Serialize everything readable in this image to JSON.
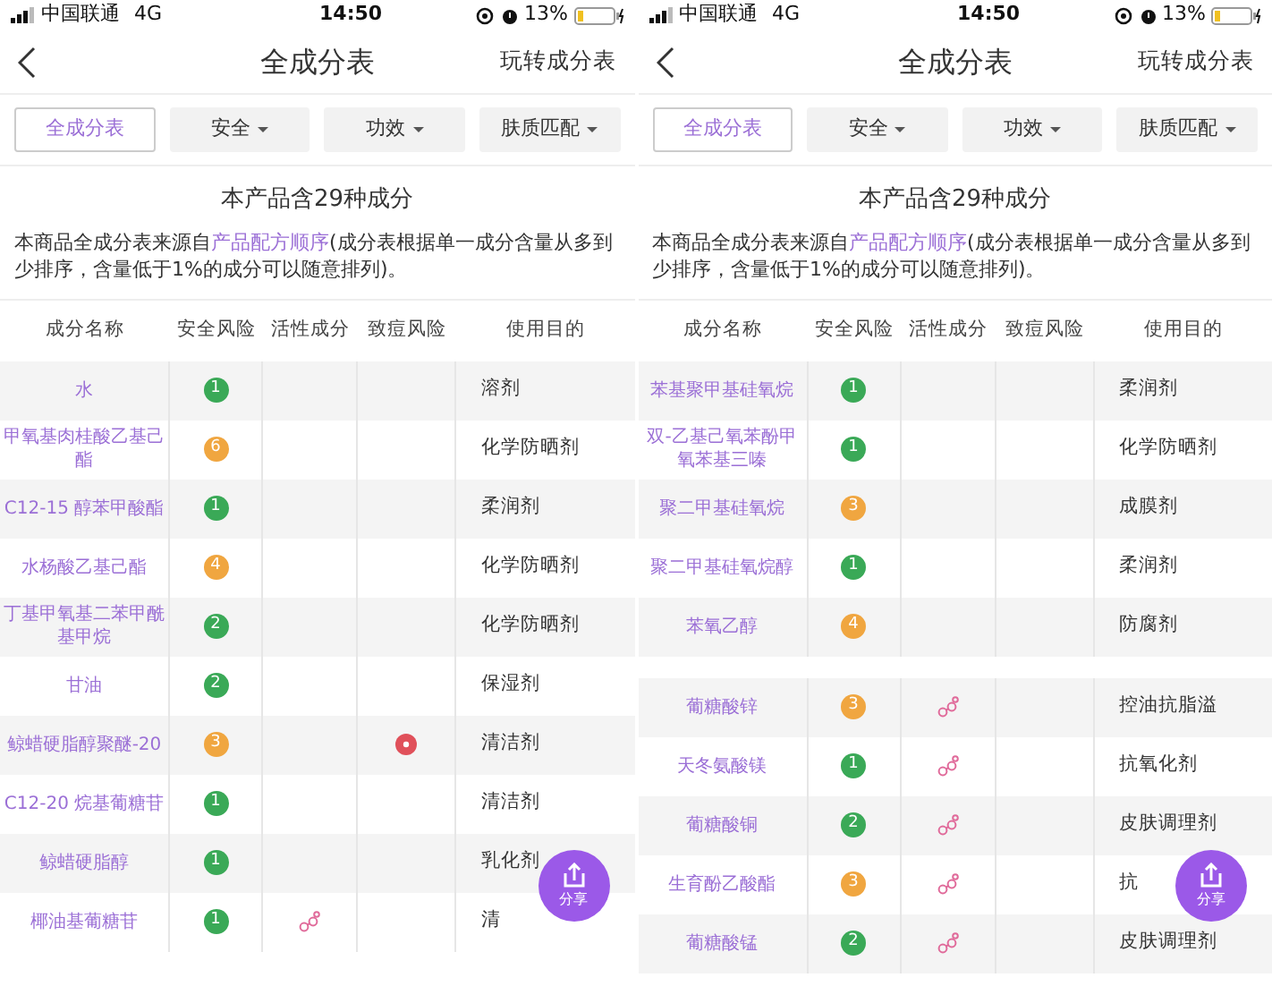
{
  "screens": [
    {
      "status_bar": {
        "carrier": "中国联通",
        "network": "4G",
        "time": "14:50",
        "battery": "13%"
      },
      "nav": {
        "title": "全成分表",
        "action": "玩转成分表"
      },
      "tabs": [
        {
          "label": "全成分表",
          "selected": true,
          "dropdown": false
        },
        {
          "label": "安全",
          "selected": false,
          "dropdown": true
        },
        {
          "label": "功效",
          "selected": false,
          "dropdown": true
        },
        {
          "label": "肤质匹配",
          "selected": false,
          "dropdown": true
        }
      ],
      "heading": "本产品含29种成分",
      "description": {
        "before": "本商品全成分表来源自",
        "link": "产品配方顺序",
        "after": "(成分表根据单一成分含量从多到少排序，含量低于1%的成分可以随意排列)。"
      },
      "columns": [
        "成分名称",
        "安全风险",
        "活性成分",
        "致痘风险",
        "使用目的"
      ],
      "groups": [
        {
          "rows": [
            {
              "name": "水",
              "score": "1",
              "color": "#3aa957",
              "active": false,
              "acne": false,
              "use": "溶剂"
            },
            {
              "name": "甲氧基肉桂酸乙基己酯",
              "score": "6",
              "color": "#f0a640",
              "active": false,
              "acne": false,
              "use": "化学防晒剂"
            },
            {
              "name": "C12-15 醇苯甲酸酯",
              "score": "1",
              "color": "#3aa957",
              "active": false,
              "acne": false,
              "use": "柔润剂"
            },
            {
              "name": "水杨酸乙基己酯",
              "score": "4",
              "color": "#f0a640",
              "active": false,
              "acne": false,
              "use": "化学防晒剂"
            },
            {
              "name": "丁基甲氧基二苯甲酰基甲烷",
              "score": "2",
              "color": "#3aa957",
              "active": false,
              "acne": false,
              "use": "化学防晒剂"
            },
            {
              "name": "甘油",
              "score": "2",
              "color": "#3aa957",
              "active": false,
              "acne": false,
              "use": "保湿剂"
            },
            {
              "name": "鲸蜡硬脂醇聚醚-20",
              "score": "3",
              "color": "#f0a640",
              "active": false,
              "acne": true,
              "use": "清洁剂"
            },
            {
              "name": "C12-20 烷基葡糖苷",
              "score": "1",
              "color": "#3aa957",
              "active": false,
              "acne": false,
              "use": "清洁剂"
            },
            {
              "name": "鲸蜡硬脂醇",
              "score": "1",
              "color": "#3aa957",
              "active": false,
              "acne": false,
              "use": "乳化剂"
            },
            {
              "name": "椰油基葡糖苷",
              "score": "1",
              "color": "#3aa957",
              "active": true,
              "acne": false,
              "use": "清"
            }
          ]
        }
      ],
      "share": "分享"
    },
    {
      "status_bar": {
        "carrier": "中国联通",
        "network": "4G",
        "time": "14:50",
        "battery": "13%"
      },
      "nav": {
        "title": "全成分表",
        "action": "玩转成分表"
      },
      "tabs": [
        {
          "label": "全成分表",
          "selected": true,
          "dropdown": false
        },
        {
          "label": "安全",
          "selected": false,
          "dropdown": true
        },
        {
          "label": "功效",
          "selected": false,
          "dropdown": true
        },
        {
          "label": "肤质匹配",
          "selected": false,
          "dropdown": true
        }
      ],
      "heading": "本产品含29种成分",
      "description": {
        "before": "本商品全成分表来源自",
        "link": "产品配方顺序",
        "after": "(成分表根据单一成分含量从多到少排序，含量低于1%的成分可以随意排列)。"
      },
      "columns": [
        "成分名称",
        "安全风险",
        "活性成分",
        "致痘风险",
        "使用目的"
      ],
      "groups": [
        {
          "rows": [
            {
              "name": "苯基聚甲基硅氧烷",
              "score": "1",
              "color": "#3aa957",
              "active": false,
              "acne": false,
              "use": "柔润剂"
            },
            {
              "name": "双-乙基己氧苯酚甲氧苯基三嗪",
              "score": "1",
              "color": "#3aa957",
              "active": false,
              "acne": false,
              "use": "化学防晒剂"
            },
            {
              "name": "聚二甲基硅氧烷",
              "score": "3",
              "color": "#f0a640",
              "active": false,
              "acne": false,
              "use": "成膜剂"
            },
            {
              "name": "聚二甲基硅氧烷醇",
              "score": "1",
              "color": "#3aa957",
              "active": false,
              "acne": false,
              "use": "柔润剂"
            },
            {
              "name": "苯氧乙醇",
              "score": "4",
              "color": "#f0a640",
              "active": false,
              "acne": false,
              "use": "防腐剂"
            }
          ]
        },
        {
          "rows": [
            {
              "name": "葡糖酸锌",
              "score": "3",
              "color": "#f0a640",
              "active": true,
              "acne": false,
              "use": "控油抗脂溢"
            },
            {
              "name": "天冬氨酸镁",
              "score": "1",
              "color": "#3aa957",
              "active": true,
              "acne": false,
              "use": "抗氧化剂"
            },
            {
              "name": "葡糖酸铜",
              "score": "2",
              "color": "#3aa957",
              "active": true,
              "acne": false,
              "use": "皮肤调理剂"
            },
            {
              "name": "生育酚乙酸酯",
              "score": "3",
              "color": "#f0a640",
              "active": true,
              "acne": false,
              "use": "抗"
            },
            {
              "name": "葡糖酸锰",
              "score": "2",
              "color": "#3aa957",
              "active": true,
              "acne": false,
              "use": "皮肤调理剂"
            }
          ]
        }
      ],
      "share": "分享"
    }
  ]
}
